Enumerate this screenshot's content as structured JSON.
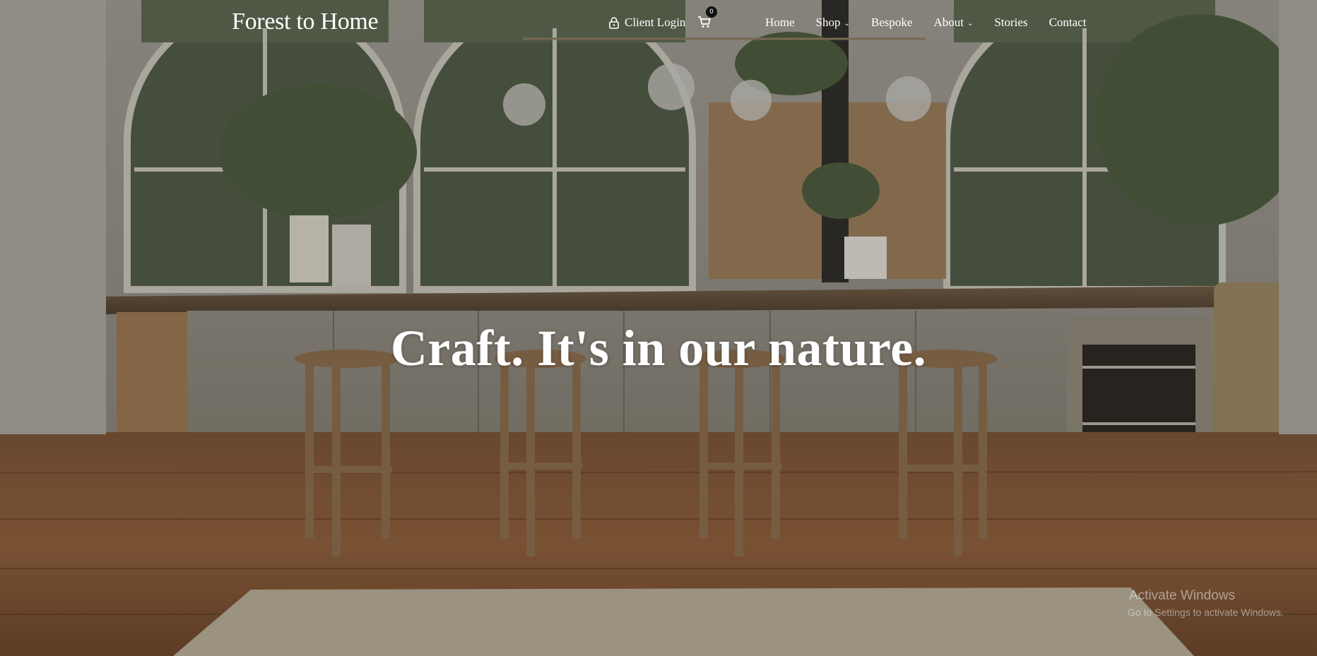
{
  "brand": {
    "logo_text": "Forest to Home"
  },
  "header": {
    "client_login_label": "Client Login",
    "cart_count": "0",
    "nav": [
      {
        "label": "Home",
        "has_dropdown": false
      },
      {
        "label": "Shop",
        "has_dropdown": true
      },
      {
        "label": "Bespoke",
        "has_dropdown": false
      },
      {
        "label": "About",
        "has_dropdown": true
      },
      {
        "label": "Stories",
        "has_dropdown": false
      },
      {
        "label": "Contact",
        "has_dropdown": false
      }
    ]
  },
  "hero": {
    "headline": "Craft. It's in our nature."
  },
  "overlay": {
    "activation_title": "Activate Windows",
    "activation_subtitle": "Go to Settings to activate Windows."
  },
  "icons": {
    "lock": "lock-icon",
    "cart": "cart-icon",
    "dropdown": "chevron-down-icon"
  }
}
